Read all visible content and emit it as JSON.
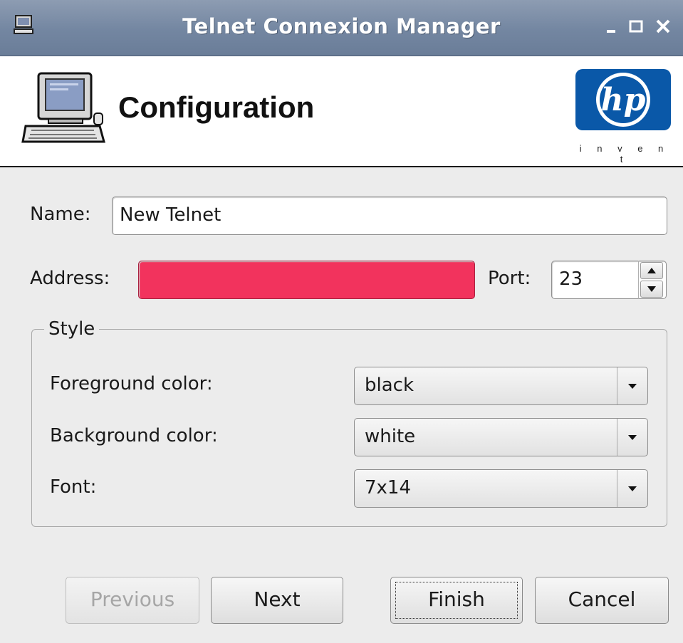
{
  "window": {
    "title": "Telnet Connexion Manager"
  },
  "header": {
    "title": "Configuration",
    "logo_tagline": "i n v e n t",
    "logo_name": "hp"
  },
  "form": {
    "name_label": "Name:",
    "name_value": "New Telnet",
    "address_label": "Address:",
    "address_value": "",
    "address_state_color": "#f2335d",
    "port_label": "Port:",
    "port_value": "23"
  },
  "style_group": {
    "legend": "Style",
    "foreground_label": "Foreground color:",
    "foreground_value": "black",
    "background_label": "Background color:",
    "background_value": "white",
    "font_label": "Font:",
    "font_value": "7x14"
  },
  "buttons": {
    "previous": "Previous",
    "next": "Next",
    "finish": "Finish",
    "cancel": "Cancel"
  },
  "icons": [
    "computer-icon",
    "minimize-icon",
    "maximize-icon",
    "close-icon",
    "workstation-icon",
    "hp-logo",
    "spin-up-icon",
    "spin-down-icon",
    "dropdown-arrow-icon"
  ]
}
